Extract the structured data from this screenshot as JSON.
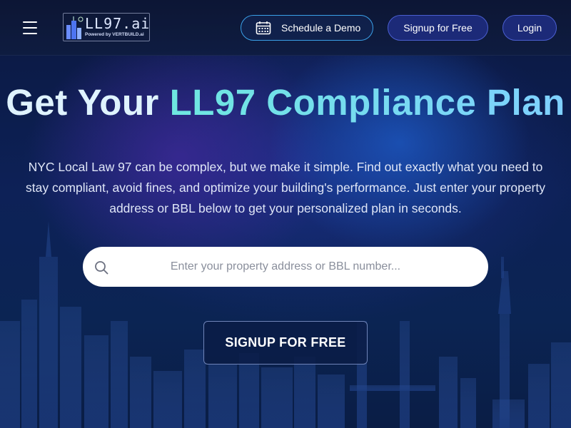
{
  "header": {
    "menu_icon": "hamburger-menu-icon",
    "logo": {
      "text": "LL97.ai",
      "subtext": "Powered by VERTBUILD.ai"
    },
    "schedule_demo_label": "Schedule a Demo",
    "schedule_demo_icon": "calendar-icon",
    "signup_label": "Signup for Free",
    "login_label": "Login"
  },
  "hero": {
    "title_part1": "Get Your ",
    "title_part2": "LL97 Compliance Plan",
    "description": "NYC Local Law 97 can be complex, but we make it simple. Find out exactly what you need to stay compliant, avoid fines, and optimize your building's performance. Just enter your property address or BBL below to get your personalized plan in seconds.",
    "search": {
      "icon": "search-icon",
      "placeholder": "Enter your property address or BBL number...",
      "value": ""
    },
    "cta_label": "SIGNUP FOR FREE"
  },
  "colors": {
    "background": "#0b1840",
    "accent_gradient_start": "#6ee7e0",
    "accent_gradient_end": "#7fd0ff",
    "button_border": "#4b5fd0",
    "demo_border": "#3aa0e8"
  }
}
